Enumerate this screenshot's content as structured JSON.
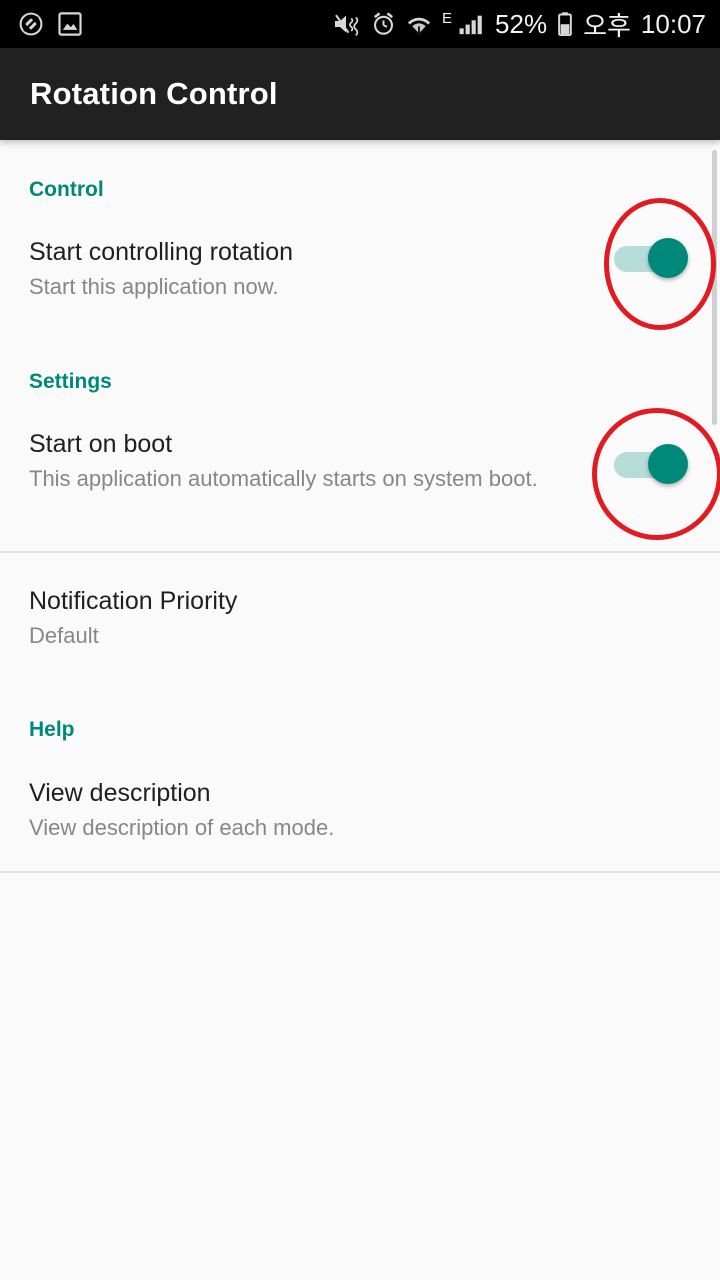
{
  "status_bar": {
    "left_icons": [
      "rotation-lock-icon",
      "screenshot-image-icon"
    ],
    "right_icons": [
      "vibrate-mute-icon",
      "alarm-clock-icon",
      "wifi-icon",
      "signal-bars-icon",
      "battery-icon"
    ],
    "network_type": "E",
    "battery_percent": "52%",
    "clock_period": "오후",
    "clock_time": "10:07",
    "background_color": "#000000"
  },
  "app_bar": {
    "title": "Rotation Control",
    "background_color": "#212121",
    "title_color": "#ffffff"
  },
  "theme": {
    "accent_color": "#00897b",
    "page_background": "#fafafa",
    "annotation_color": "#e11b22",
    "switch_track_on": "#b6dcd8",
    "switch_thumb_on": "#00897b"
  },
  "sections": [
    {
      "header": "Control",
      "rows": [
        {
          "title": "Start controlling rotation",
          "summary": "Start this application now.",
          "control": "switch",
          "switch_state": "on",
          "annotated": true
        }
      ]
    },
    {
      "header": "Settings",
      "rows": [
        {
          "title": "Start on boot",
          "summary": "This application automatically starts on system boot.",
          "control": "switch",
          "switch_state": "on",
          "annotated": true
        },
        {
          "title": "Notification Priority",
          "summary": "Default",
          "control": "none",
          "switch_state": "",
          "annotated": false
        }
      ]
    },
    {
      "header": "Help",
      "rows": [
        {
          "title": "View description",
          "summary": "View description of each mode.",
          "control": "none",
          "switch_state": "",
          "annotated": false
        }
      ]
    }
  ]
}
